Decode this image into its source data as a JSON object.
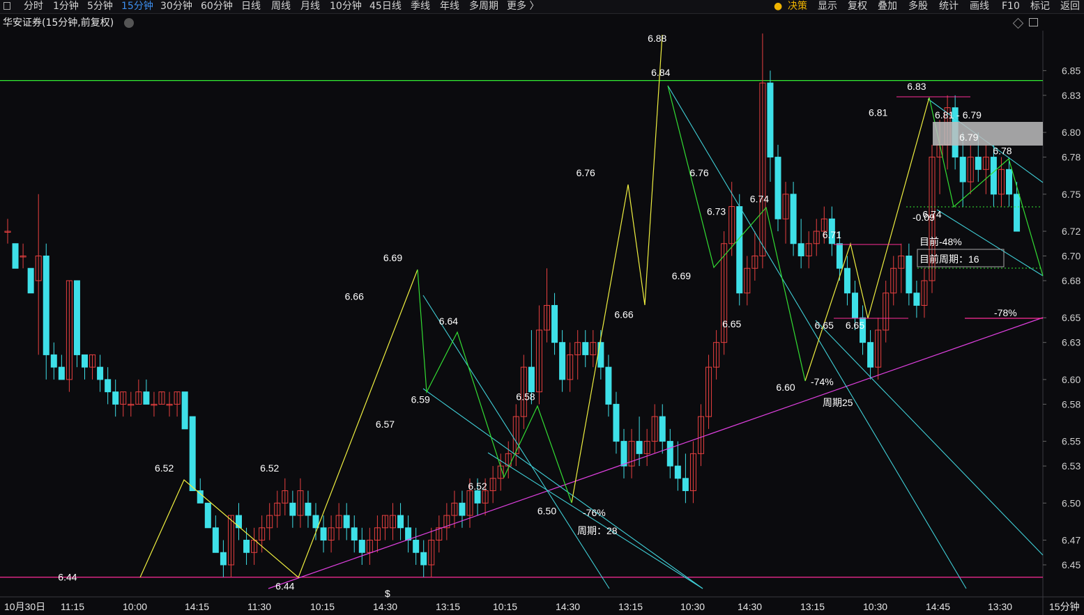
{
  "toolbar": {
    "tabs": [
      "分时",
      "1分钟",
      "5分钟",
      "15分钟",
      "30分钟",
      "60分钟",
      "日线",
      "周线",
      "月线",
      "10分钟",
      "45日线",
      "季线",
      "年线",
      "多周期",
      "更多 〉"
    ],
    "active_tab": "15分钟",
    "right": [
      "决策",
      "显示",
      "复权",
      "叠加",
      "多股",
      "统计",
      "画线",
      "F10",
      "标记",
      "返回"
    ]
  },
  "chart_title": "华安证券(15分钟,前复权)",
  "x_axis_labels": [
    "10月30日",
    "11:15",
    "10:00",
    "14:15",
    "11:30",
    "10:15",
    "14:30",
    "13:15",
    "10:15",
    "14:30",
    "13:15",
    "10:30",
    "14:30",
    "13:15",
    "10:30",
    "14:45",
    "13:30"
  ],
  "x_axis_unit": "15分钟",
  "colors": {
    "up": "#e84040",
    "down": "#3ee0e8",
    "zigzag_yellow": "#f0f040",
    "zigzag_green": "#33dd33",
    "trend_magenta": "#e040e0",
    "channel_cyan": "#40d0d8",
    "hline_green": "#33ee33",
    "hline_pink": "#ff2d98"
  },
  "chart_data": {
    "type": "candlestick",
    "ylim": [
      6.43,
      6.91
    ],
    "y_ticks": [
      "6.85",
      "6.83",
      "6.80",
      "6.78",
      "6.75",
      "6.72",
      "6.70",
      "6.68",
      "6.65",
      "6.63",
      "6.60",
      "6.58",
      "6.55",
      "6.53",
      "6.50",
      "6.47",
      "6.45"
    ],
    "price_labels": [
      {
        "text": "6.44",
        "x": 6,
        "y": 6.44
      },
      {
        "text": "6.52",
        "x": 20,
        "y": 6.52
      },
      {
        "text": "6.44",
        "x": 36,
        "y": 6.44
      },
      {
        "text": "6.52",
        "x": 34,
        "y": 6.52
      },
      {
        "text": "6.66",
        "x": 45,
        "y": 6.66
      },
      {
        "text": "6.69",
        "x": 50,
        "y": 6.69
      },
      {
        "text": "6.57",
        "x": 49,
        "y": 6.57
      },
      {
        "text": "6.59",
        "x": 52,
        "y": 6.59
      },
      {
        "text": "6.64",
        "x": 56,
        "y": 6.64
      },
      {
        "text": "6.52",
        "x": 61,
        "y": 6.52
      },
      {
        "text": "6.58",
        "x": 66,
        "y": 6.58
      },
      {
        "text": "6.50",
        "x": 70,
        "y": 6.5
      },
      {
        "text": "6.76",
        "x": 77,
        "y": 6.76
      },
      {
        "text": "6.66",
        "x": 80,
        "y": 6.66
      },
      {
        "text": "6.88",
        "x": 82,
        "y": 6.88
      },
      {
        "text": "6.84",
        "x": 83,
        "y": 6.84
      },
      {
        "text": "6.76",
        "x": 88,
        "y": 6.76
      },
      {
        "text": "6.69",
        "x": 88,
        "y": 6.69
      },
      {
        "text": "6.73",
        "x": 92,
        "y": 6.73
      },
      {
        "text": "6.74",
        "x": 96,
        "y": 6.74
      },
      {
        "text": "6.65",
        "x": 94,
        "y": 6.65
      },
      {
        "text": "6.60",
        "x": 101,
        "y": 6.6
      },
      {
        "text": "6.71",
        "x": 107,
        "y": 6.71
      },
      {
        "text": "6.65",
        "x": 106,
        "y": 6.65
      },
      {
        "text": "6.65",
        "x": 110,
        "y": 6.65
      },
      {
        "text": "6.81",
        "x": 113,
        "y": 6.81
      },
      {
        "text": "6.83",
        "x": 118,
        "y": 6.83
      },
      {
        "text": "6.79",
        "x": 123,
        "y": 6.79
      },
      {
        "text": "6.74",
        "x": 120,
        "y": 6.74
      },
      {
        "text": "6.78",
        "x": 127,
        "y": 6.78
      }
    ],
    "annotations": [
      {
        "text": "-76%",
        "color": "#33ee33",
        "size": 20
      },
      {
        "text": "周期：28",
        "color": "#33ee33",
        "size": 18
      },
      {
        "text": "-74%",
        "color": "#33ee33",
        "size": 20
      },
      {
        "text": "周期25",
        "color": "#33ee33",
        "size": 18
      },
      {
        "text": "6.81 - 6.79",
        "color": "#ffffff",
        "size": 14
      },
      {
        "text": "-0.09",
        "color": "#33ee33",
        "size": 14
      },
      {
        "text": "目前-48%",
        "color": "#33ee33",
        "size": 18
      },
      {
        "text": "目前周期：16",
        "color": "#33ee33",
        "size": 18
      },
      {
        "text": "-78%",
        "color": "#ff2d98",
        "size": 20
      }
    ],
    "horizontal_lines": [
      {
        "price": 6.842,
        "color": "#33ee33"
      },
      {
        "price": 6.44,
        "color": "#ff2d98"
      }
    ],
    "candles": [
      [
        6.72,
        6.73,
        6.71,
        6.72
      ],
      [
        6.71,
        6.71,
        6.69,
        6.69
      ],
      [
        6.7,
        6.71,
        6.69,
        6.7
      ],
      [
        6.69,
        6.69,
        6.67,
        6.67
      ],
      [
        6.68,
        6.75,
        6.62,
        6.7
      ],
      [
        6.7,
        6.71,
        6.6,
        6.62
      ],
      [
        6.62,
        6.63,
        6.6,
        6.61
      ],
      [
        6.61,
        6.62,
        6.6,
        6.6
      ],
      [
        6.6,
        6.68,
        6.59,
        6.68
      ],
      [
        6.68,
        6.68,
        6.61,
        6.62
      ],
      [
        6.62,
        6.62,
        6.6,
        6.61
      ],
      [
        6.61,
        6.62,
        6.6,
        6.62
      ],
      [
        6.61,
        6.62,
        6.59,
        6.6
      ],
      [
        6.6,
        6.61,
        6.58,
        6.59
      ],
      [
        6.59,
        6.6,
        6.57,
        6.58
      ],
      [
        6.58,
        6.59,
        6.57,
        6.59
      ],
      [
        6.58,
        6.59,
        6.57,
        6.58
      ],
      [
        6.58,
        6.6,
        6.58,
        6.59
      ],
      [
        6.59,
        6.6,
        6.58,
        6.58
      ],
      [
        6.58,
        6.59,
        6.57,
        6.58
      ],
      [
        6.58,
        6.59,
        6.58,
        6.59
      ],
      [
        6.58,
        6.59,
        6.57,
        6.58
      ],
      [
        6.58,
        6.59,
        6.57,
        6.59
      ],
      [
        6.59,
        6.59,
        6.56,
        6.56
      ],
      [
        6.57,
        6.57,
        6.51,
        6.51
      ],
      [
        6.51,
        6.52,
        6.5,
        6.5
      ],
      [
        6.5,
        6.5,
        6.48,
        6.48
      ],
      [
        6.48,
        6.49,
        6.46,
        6.46
      ],
      [
        6.46,
        6.47,
        6.44,
        6.45
      ],
      [
        6.45,
        6.49,
        6.44,
        6.49
      ],
      [
        6.49,
        6.5,
        6.47,
        6.48
      ],
      [
        6.47,
        6.48,
        6.45,
        6.46
      ],
      [
        6.46,
        6.48,
        6.45,
        6.47
      ],
      [
        6.47,
        6.49,
        6.46,
        6.48
      ],
      [
        6.48,
        6.5,
        6.47,
        6.49
      ],
      [
        6.49,
        6.51,
        6.48,
        6.5
      ],
      [
        6.5,
        6.52,
        6.49,
        6.51
      ],
      [
        6.5,
        6.51,
        6.48,
        6.49
      ],
      [
        6.49,
        6.52,
        6.48,
        6.51
      ],
      [
        6.5,
        6.51,
        6.48,
        6.49
      ],
      [
        6.49,
        6.5,
        6.47,
        6.48
      ],
      [
        6.48,
        6.49,
        6.46,
        6.47
      ],
      [
        6.47,
        6.49,
        6.46,
        6.48
      ],
      [
        6.48,
        6.5,
        6.47,
        6.49
      ],
      [
        6.49,
        6.5,
        6.47,
        6.48
      ],
      [
        6.48,
        6.49,
        6.46,
        6.47
      ],
      [
        6.47,
        6.48,
        6.45,
        6.46
      ],
      [
        6.46,
        6.48,
        6.45,
        6.47
      ],
      [
        6.47,
        6.49,
        6.46,
        6.48
      ],
      [
        6.48,
        6.49,
        6.47,
        6.49
      ],
      [
        6.48,
        6.5,
        6.47,
        6.49
      ],
      [
        6.49,
        6.5,
        6.47,
        6.48
      ],
      [
        6.48,
        6.49,
        6.46,
        6.47
      ],
      [
        6.47,
        6.48,
        6.45,
        6.46
      ],
      [
        6.46,
        6.47,
        6.44,
        6.45
      ],
      [
        6.45,
        6.48,
        6.44,
        6.47
      ],
      [
        6.47,
        6.49,
        6.46,
        6.48
      ],
      [
        6.48,
        6.5,
        6.47,
        6.49
      ],
      [
        6.49,
        6.51,
        6.48,
        6.5
      ],
      [
        6.5,
        6.51,
        6.48,
        6.49
      ],
      [
        6.49,
        6.52,
        6.48,
        6.51
      ],
      [
        6.51,
        6.52,
        6.49,
        6.5
      ],
      [
        6.5,
        6.52,
        6.49,
        6.51
      ],
      [
        6.51,
        6.53,
        6.5,
        6.52
      ],
      [
        6.52,
        6.54,
        6.51,
        6.53
      ],
      [
        6.53,
        6.55,
        6.52,
        6.54
      ],
      [
        6.54,
        6.58,
        6.53,
        6.57
      ],
      [
        6.57,
        6.62,
        6.56,
        6.61
      ],
      [
        6.61,
        6.64,
        6.58,
        6.59
      ],
      [
        6.59,
        6.66,
        6.58,
        6.64
      ],
      [
        6.64,
        6.69,
        6.63,
        6.66
      ],
      [
        6.66,
        6.67,
        6.62,
        6.63
      ],
      [
        6.63,
        6.64,
        6.59,
        6.6
      ],
      [
        6.6,
        6.63,
        6.59,
        6.62
      ],
      [
        6.62,
        6.64,
        6.6,
        6.63
      ],
      [
        6.63,
        6.64,
        6.61,
        6.62
      ],
      [
        6.62,
        6.64,
        6.61,
        6.63
      ],
      [
        6.63,
        6.64,
        6.6,
        6.61
      ],
      [
        6.61,
        6.62,
        6.57,
        6.58
      ],
      [
        6.58,
        6.59,
        6.54,
        6.55
      ],
      [
        6.55,
        6.56,
        6.52,
        6.53
      ],
      [
        6.53,
        6.56,
        6.52,
        6.55
      ],
      [
        6.55,
        6.57,
        6.53,
        6.54
      ],
      [
        6.54,
        6.56,
        6.53,
        6.55
      ],
      [
        6.55,
        6.58,
        6.54,
        6.57
      ],
      [
        6.57,
        6.58,
        6.54,
        6.55
      ],
      [
        6.55,
        6.56,
        6.52,
        6.53
      ],
      [
        6.53,
        6.55,
        6.51,
        6.52
      ],
      [
        6.52,
        6.54,
        6.5,
        6.51
      ],
      [
        6.51,
        6.55,
        6.5,
        6.54
      ],
      [
        6.54,
        6.58,
        6.53,
        6.57
      ],
      [
        6.57,
        6.62,
        6.56,
        6.61
      ],
      [
        6.61,
        6.64,
        6.6,
        6.63
      ],
      [
        6.63,
        6.72,
        6.62,
        6.71
      ],
      [
        6.71,
        6.76,
        6.7,
        6.74
      ],
      [
        6.74,
        6.75,
        6.66,
        6.67
      ],
      [
        6.67,
        6.7,
        6.66,
        6.69
      ],
      [
        6.69,
        6.72,
        6.68,
        6.7
      ],
      [
        6.7,
        6.88,
        6.69,
        6.84
      ],
      [
        6.84,
        6.85,
        6.76,
        6.78
      ],
      [
        6.78,
        6.79,
        6.72,
        6.73
      ],
      [
        6.73,
        6.76,
        6.71,
        6.75
      ],
      [
        6.75,
        6.76,
        6.7,
        6.71
      ],
      [
        6.71,
        6.73,
        6.69,
        6.7
      ],
      [
        6.7,
        6.72,
        6.69,
        6.71
      ],
      [
        6.71,
        6.73,
        6.7,
        6.72
      ],
      [
        6.72,
        6.74,
        6.71,
        6.73
      ],
      [
        6.73,
        6.74,
        6.7,
        6.71
      ],
      [
        6.71,
        6.72,
        6.68,
        6.69
      ],
      [
        6.69,
        6.7,
        6.66,
        6.67
      ],
      [
        6.67,
        6.68,
        6.64,
        6.65
      ],
      [
        6.65,
        6.66,
        6.62,
        6.63
      ],
      [
        6.63,
        6.64,
        6.6,
        6.61
      ],
      [
        6.61,
        6.65,
        6.6,
        6.64
      ],
      [
        6.64,
        6.68,
        6.63,
        6.67
      ],
      [
        6.67,
        6.7,
        6.66,
        6.69
      ],
      [
        6.69,
        6.71,
        6.67,
        6.7
      ],
      [
        6.7,
        6.71,
        6.66,
        6.67
      ],
      [
        6.67,
        6.68,
        6.65,
        6.66
      ],
      [
        6.66,
        6.69,
        6.65,
        6.68
      ],
      [
        6.68,
        6.79,
        6.67,
        6.78
      ],
      [
        6.78,
        6.81,
        6.75,
        6.79
      ],
      [
        6.79,
        6.83,
        6.77,
        6.82
      ],
      [
        6.82,
        6.83,
        6.77,
        6.78
      ],
      [
        6.78,
        6.8,
        6.74,
        6.76
      ],
      [
        6.76,
        6.79,
        6.75,
        6.78
      ],
      [
        6.78,
        6.8,
        6.76,
        6.77
      ],
      [
        6.77,
        6.79,
        6.75,
        6.78
      ],
      [
        6.78,
        6.79,
        6.74,
        6.75
      ],
      [
        6.75,
        6.78,
        6.74,
        6.77
      ],
      [
        6.77,
        6.78,
        6.74,
        6.75
      ],
      [
        6.75,
        6.76,
        6.72,
        6.72
      ]
    ]
  }
}
